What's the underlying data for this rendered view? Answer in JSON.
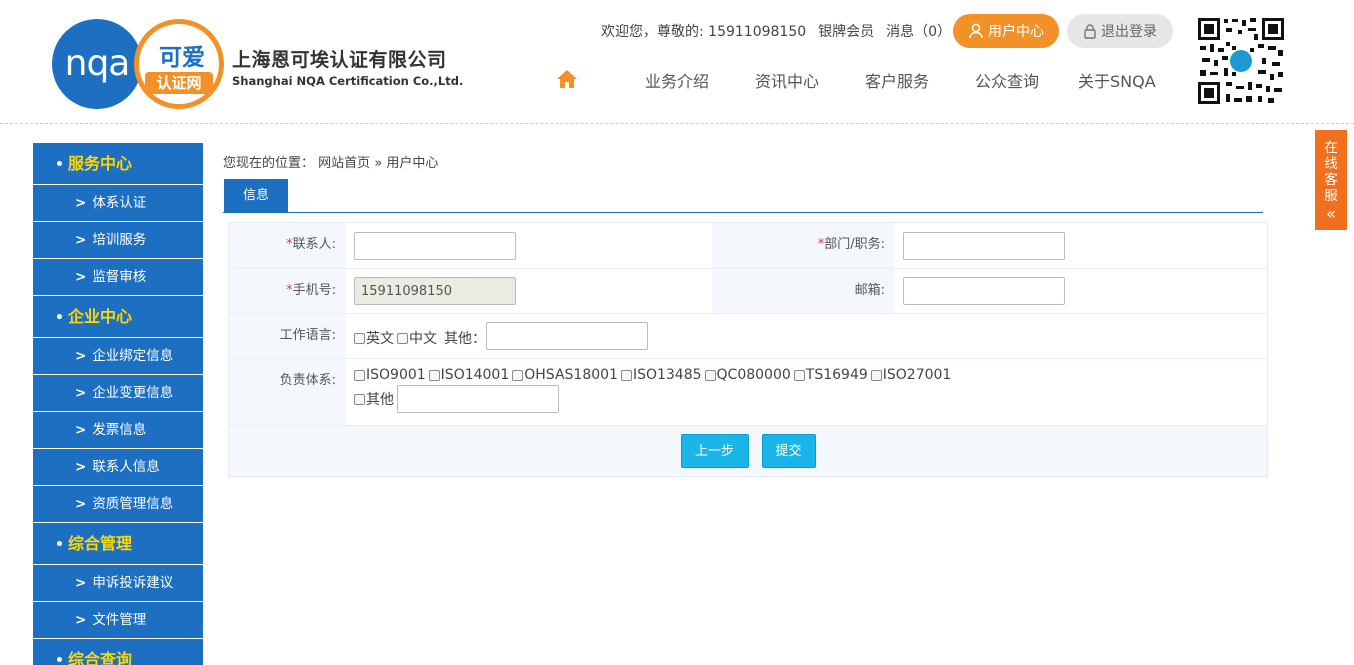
{
  "logo": {
    "text_left": "nqa",
    "text_right_top": "可爱",
    "text_right_bottom": "认证网"
  },
  "company": {
    "cn": "上海恩可埃认证有限公司",
    "en": "Shanghai NQA Certification Co.,Ltd."
  },
  "userbar": {
    "welcome": "欢迎您，尊敬的: 15911098150",
    "level": "银牌会员",
    "messages": "消息（0）",
    "user_center": "用户中心",
    "logout": "退出登录"
  },
  "nav": {
    "items": [
      "业务介绍",
      "资讯中心",
      "客户服务",
      "公众查询",
      "关于SNQA"
    ]
  },
  "float": {
    "chars": [
      "在",
      "线",
      "客",
      "服"
    ],
    "arrow": "«"
  },
  "sidebar": {
    "sections": [
      {
        "title": "服务中心",
        "items": [
          "体系认证",
          "培训服务",
          "监督审核"
        ]
      },
      {
        "title": "企业中心",
        "items": [
          "企业绑定信息",
          "企业变更信息",
          "发票信息",
          "联系人信息",
          "资质管理信息"
        ]
      },
      {
        "title": "综合管理",
        "items": [
          "申诉投诉建议",
          "文件管理"
        ]
      },
      {
        "title": "综合查询",
        "items": []
      }
    ]
  },
  "breadcrumb": {
    "prefix": "您现在的位置：",
    "home": "网站首页",
    "sep": "»",
    "current": "用户中心"
  },
  "tab": {
    "label": "信息"
  },
  "form": {
    "contact_label": "联系人:",
    "contact_value": "",
    "dept_label": "部门/职务:",
    "dept_value": "",
    "phone_label": "手机号:",
    "phone_value": "15911098150",
    "email_label": "邮箱:",
    "email_value": "",
    "lang_label": "工作语言:",
    "lang_options": [
      "英文",
      "中文"
    ],
    "lang_other_label": "其他：",
    "lang_other_value": "",
    "system_label": "负责体系:",
    "system_options": [
      "ISO9001",
      "ISO14001",
      "OHSAS18001",
      "ISO13485",
      "QC080000",
      "TS16949",
      "ISO27001"
    ],
    "system_other_label": "其他",
    "system_other_value": "",
    "prev_button": "上一步",
    "submit_button": "提交"
  },
  "colors": {
    "primary": "#1c6fc1",
    "accent": "#f39129",
    "highlight": "#ffd700",
    "button": "#1ab6ea",
    "float": "#f07020"
  }
}
